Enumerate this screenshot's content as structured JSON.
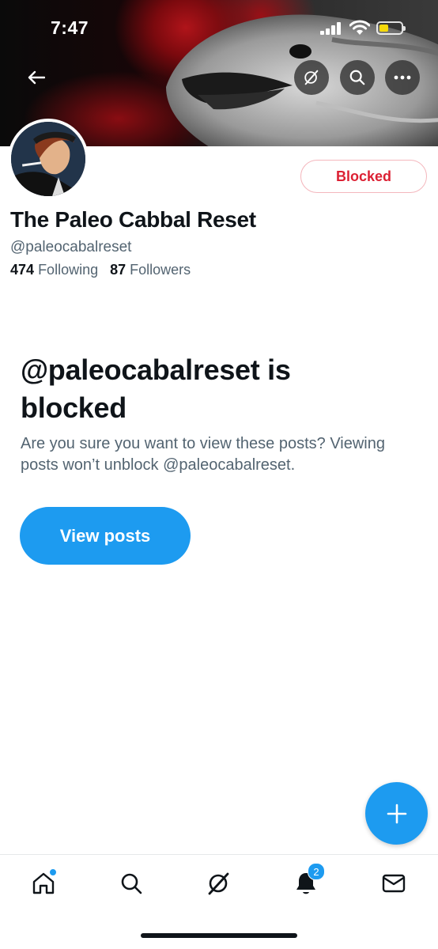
{
  "status_bar": {
    "time": "7:47"
  },
  "header": {
    "back_icon": "arrow-left-icon",
    "grok_icon": "grok-icon",
    "search_icon": "search-icon",
    "more_icon": "more-horizontal-icon"
  },
  "profile": {
    "display_name": "The Paleo Cabbal Reset",
    "handle": "@paleocabalreset",
    "following_count": "474",
    "following_label": "Following",
    "followers_count": "87",
    "followers_label": "Followers",
    "blocked_button_label": "Blocked"
  },
  "blocked_notice": {
    "title": "@paleocabalreset is blocked",
    "description": "Are you sure you want to view these posts? Viewing posts won’t unblock @paleocabalreset.",
    "view_posts_label": "View posts"
  },
  "fab": {
    "icon": "plus-icon"
  },
  "bottom_nav": {
    "items": [
      {
        "name": "home",
        "icon": "home-icon",
        "has_dot": true
      },
      {
        "name": "search",
        "icon": "search-icon"
      },
      {
        "name": "grok",
        "icon": "grok-icon"
      },
      {
        "name": "notifications",
        "icon": "bell-icon",
        "badge": "2"
      },
      {
        "name": "messages",
        "icon": "mail-icon"
      }
    ]
  },
  "colors": {
    "accent": "#1d9bf0",
    "blocked_red": "#dc2033",
    "secondary_text": "#536471",
    "primary_text": "#0f1419"
  }
}
